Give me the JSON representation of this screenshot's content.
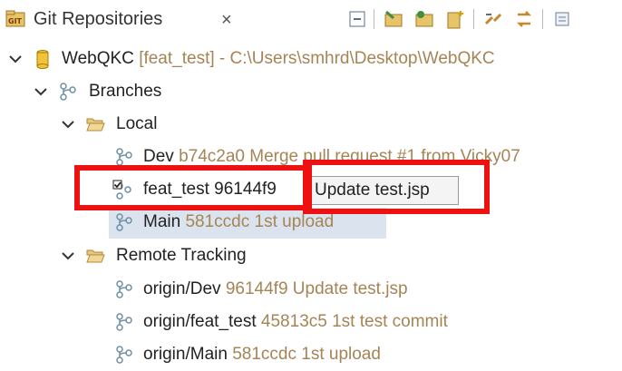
{
  "tab": {
    "title": "Git Repositories",
    "close_glyph": "×",
    "icon": "git-repositories-icon"
  },
  "toolbar": {
    "buttons": [
      "collapse-all-icon",
      "add-repository-icon",
      "clone-repository-icon",
      "create-repository-icon",
      "link-with-selection-icon",
      "refresh-icon",
      "view-menu-icon"
    ]
  },
  "tree": {
    "repo": {
      "name": "WebQKC",
      "branch": "[feat_test]",
      "path": "- C:\\Users\\smhrd\\Desktop\\WebQKC"
    },
    "branches_label": "Branches",
    "local": {
      "label": "Local",
      "items": [
        {
          "name": "Dev",
          "deco": "b74c2a0 Merge pull request #1 from Vicky07"
        },
        {
          "name": "feat_test",
          "deco": "96144f9"
        },
        {
          "name": "Main",
          "deco": "581ccdc 1st upload"
        }
      ]
    },
    "remote": {
      "label": "Remote Tracking",
      "items": [
        {
          "name": "origin/Dev",
          "deco": "96144f9 Update test.jsp"
        },
        {
          "name": "origin/feat_test",
          "deco": "45813c5 1st test commit"
        },
        {
          "name": "origin/Main",
          "deco": "581ccdc 1st upload"
        }
      ]
    }
  },
  "tooltip": {
    "text": "Update test.jsp"
  },
  "colors": {
    "highlight": "#ee1111",
    "decoration": "#a58455",
    "selection": "#dbe4ee"
  }
}
